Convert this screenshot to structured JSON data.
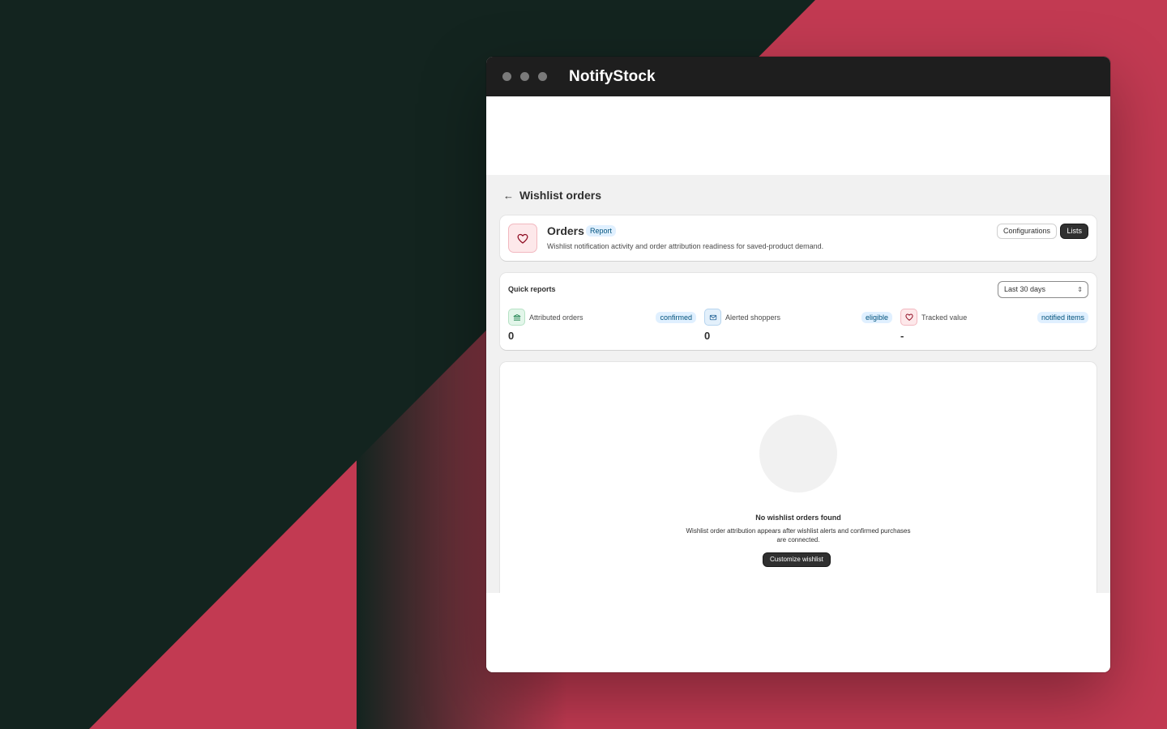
{
  "window": {
    "title": "NotifyStock"
  },
  "page": {
    "title": "Wishlist orders"
  },
  "orders_card": {
    "title": "Orders",
    "badge": "Report",
    "description": "Wishlist notification activity and order attribution readiness for saved-product demand.",
    "actions": {
      "configurations": "Configurations",
      "lists": "Lists"
    }
  },
  "quick_reports": {
    "title": "Quick reports",
    "date_range": "Last 30 days",
    "metrics": [
      {
        "label": "Attributed orders",
        "badge": "confirmed",
        "value": "0",
        "icon": "bank-icon"
      },
      {
        "label": "Alerted shoppers",
        "badge": "eligible",
        "value": "0",
        "icon": "mail-icon"
      },
      {
        "label": "Tracked value",
        "badge": "notified items",
        "value": "-",
        "icon": "heart-icon"
      }
    ]
  },
  "empty_state": {
    "title": "No wishlist orders found",
    "description": "Wishlist order attribution appears after wishlist alerts and confirmed purchases are connected.",
    "action": "Customize wishlist"
  },
  "colors": {
    "background_dark": "#13241f",
    "background_accent": "#c23a52",
    "titlebar": "#1e1e1e",
    "primary_button": "#303030"
  }
}
